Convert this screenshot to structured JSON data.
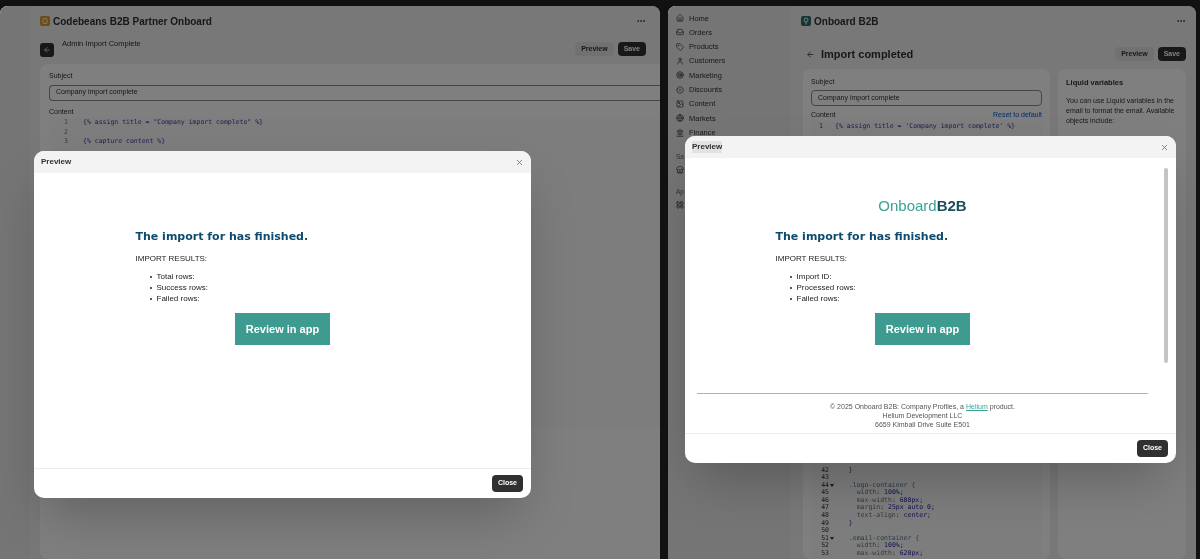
{
  "left_window": {
    "app_title": "Codebeans B2B Partner Onboard",
    "page_title": "Admin Import Complete",
    "actions": [
      {
        "label": "Preview",
        "kind": "secondary"
      },
      {
        "label": "Save",
        "kind": "primary"
      }
    ],
    "subject_label": "Subject",
    "subject_value": "Company import complete",
    "content_label": "Content",
    "code_lines": [
      {
        "number": "1",
        "text": "{% assign title = \"Company import complete\" %}"
      },
      {
        "number": "2"
      },
      {
        "number": "3",
        "text": "{% capture content %}"
      }
    ],
    "preview": {
      "title": "Preview",
      "heading": "The import for has finished.",
      "results_label": "IMPORT RESULTS:",
      "items": [
        "Total rows:",
        "Success rows:",
        "Failed rows:"
      ],
      "button": "Review in app",
      "close": "Close"
    }
  },
  "right_window": {
    "sidebar": {
      "items": [
        {
          "label": "Home"
        },
        {
          "label": "Orders"
        },
        {
          "label": "Products"
        },
        {
          "label": "Customers"
        },
        {
          "label": "Marketing"
        },
        {
          "label": "Discounts"
        },
        {
          "label": "Content"
        },
        {
          "label": "Markets"
        },
        {
          "label": "Finance"
        }
      ],
      "section_labels": [
        "Sa",
        "Ap"
      ]
    },
    "app_title": "Onboard B2B",
    "page_title": "Import completed",
    "actions": [
      {
        "label": "Preview",
        "kind": "secondary"
      },
      {
        "label": "Save",
        "kind": "primary"
      }
    ],
    "subject_label": "Subject",
    "subject_value": "Company import complete",
    "content_label": "Content",
    "reset_link": "Reset to default",
    "first_code_line": {
      "number": "1",
      "text": "{% assign title = 'Company import complete' %}"
    },
    "code_lines": [
      {
        "number": "42",
        "text": "  }",
        "foldable": false
      },
      {
        "number": "43",
        "foldable": false
      },
      {
        "number": "44",
        "text": "  .logo-container {",
        "foldable": true
      },
      {
        "number": "45",
        "text": "    width: 100%;",
        "foldable": false
      },
      {
        "number": "46",
        "text": "    max-width: 600px;",
        "foldable": false
      },
      {
        "number": "47",
        "text": "    margin: 25px auto 0;",
        "foldable": false
      },
      {
        "number": "48",
        "text": "    text-align: center;",
        "foldable": false
      },
      {
        "number": "49",
        "text": "  }",
        "foldable": false
      },
      {
        "number": "50",
        "foldable": false
      },
      {
        "number": "51",
        "text": "  .email-container {",
        "foldable": true
      },
      {
        "number": "52",
        "text": "    width: 100%;",
        "foldable": false
      },
      {
        "number": "53",
        "text": "    max-width: 620px;",
        "foldable": false
      }
    ],
    "liquid": {
      "title": "Liquid variables",
      "text": "You can use Liquid variables in the email to format the email. Available objects include:"
    },
    "preview": {
      "title": "Preview",
      "logo": {
        "first": "Onboard",
        "second": "B2B"
      },
      "heading": "The import for has finished.",
      "results_label": "IMPORT RESULTS:",
      "items": [
        "Import ID:",
        "Processed rows:",
        "Failed rows:"
      ],
      "button": "Review in app",
      "footer": {
        "before": "© 2025 Onboard B2B: Company Profiles, a",
        "link": "Helium",
        "after": "product."
      },
      "company": "Helium Development LLC",
      "address": "6659 Kimball Drive Suite E501",
      "close": "Close"
    }
  }
}
